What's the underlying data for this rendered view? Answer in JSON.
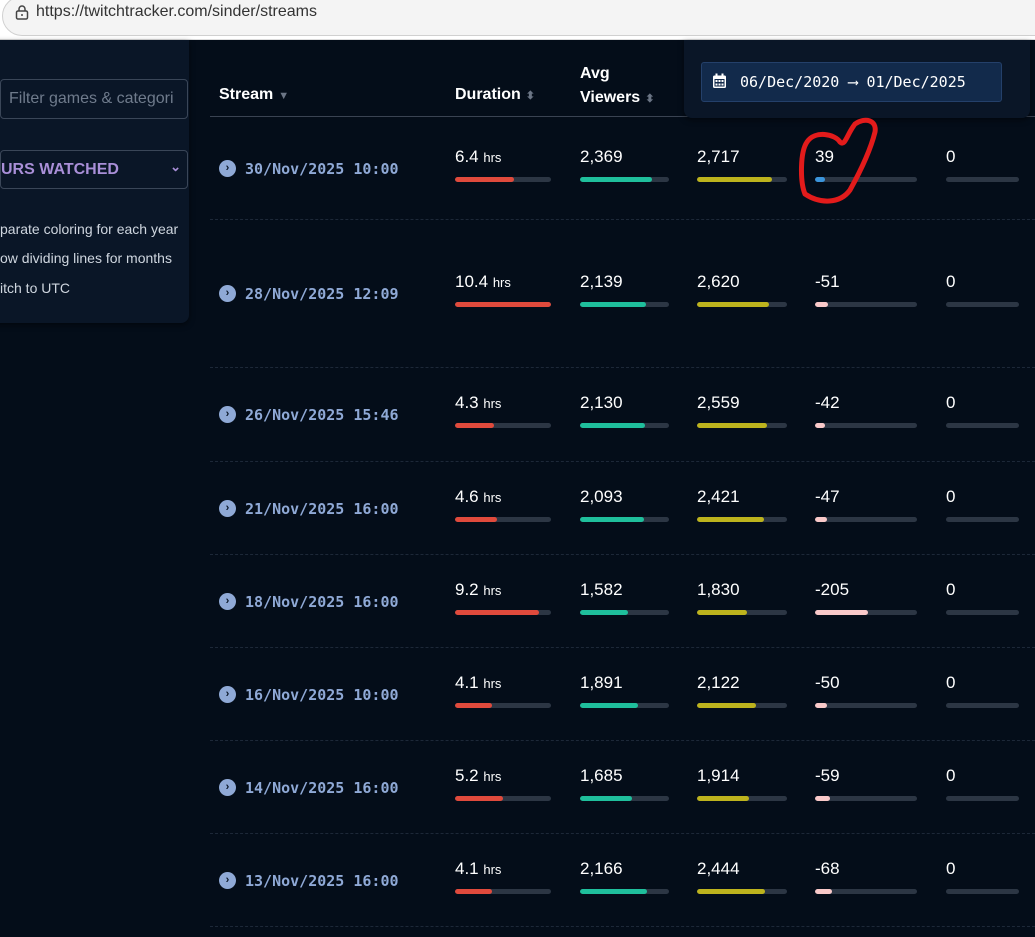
{
  "browser": {
    "url": "https://twitchtracker.com/sinder/streams"
  },
  "sidebar": {
    "filter_placeholder": "Filter games & categori",
    "sort_select": "URS WATCHED",
    "options": [
      "parate coloring for each year",
      "ow dividing lines for months",
      "itch to UTC"
    ]
  },
  "date_range": {
    "from": "06/Dec/2020",
    "arrow": "⟶",
    "to": "01/Dec/2025"
  },
  "table": {
    "headers": {
      "stream": "Stream",
      "duration": "Duration",
      "avg_viewers_1": "Avg",
      "avg_viewers_2": "Viewers"
    },
    "unit": "hrs",
    "colors": {
      "duration": "#e04a3c",
      "avg": "#1fbf9c",
      "peak": "#bdb31d",
      "followers_pos": "#3b95dc",
      "followers_neg": "#f9c9c9"
    },
    "rows": [
      {
        "date": "30/Nov/2025 10:00",
        "duration": "6.4",
        "duration_frac": 0.61,
        "avg": "2,369",
        "avg_frac": 0.81,
        "peak": "2,717",
        "peak_frac": 0.83,
        "followers": "39",
        "followers_frac": 0.1,
        "last": "0"
      },
      {
        "date": "28/Nov/2025 12:09",
        "duration": "10.4",
        "duration_frac": 1.0,
        "avg": "2,139",
        "avg_frac": 0.74,
        "peak": "2,620",
        "peak_frac": 0.8,
        "followers": "-51",
        "followers_frac": 0.13,
        "last": "0"
      },
      {
        "date": "26/Nov/2025 15:46",
        "duration": "4.3",
        "duration_frac": 0.41,
        "avg": "2,130",
        "avg_frac": 0.73,
        "peak": "2,559",
        "peak_frac": 0.78,
        "followers": "-42",
        "followers_frac": 0.1,
        "last": "0"
      },
      {
        "date": "21/Nov/2025 16:00",
        "duration": "4.6",
        "duration_frac": 0.44,
        "avg": "2,093",
        "avg_frac": 0.72,
        "peak": "2,421",
        "peak_frac": 0.74,
        "followers": "-47",
        "followers_frac": 0.12,
        "last": "0"
      },
      {
        "date": "18/Nov/2025 16:00",
        "duration": "9.2",
        "duration_frac": 0.88,
        "avg": "1,582",
        "avg_frac": 0.54,
        "peak": "1,830",
        "peak_frac": 0.56,
        "followers": "-205",
        "followers_frac": 0.52,
        "last": "0"
      },
      {
        "date": "16/Nov/2025 10:00",
        "duration": "4.1",
        "duration_frac": 0.39,
        "avg": "1,891",
        "avg_frac": 0.65,
        "peak": "2,122",
        "peak_frac": 0.65,
        "followers": "-50",
        "followers_frac": 0.12,
        "last": "0"
      },
      {
        "date": "14/Nov/2025 16:00",
        "duration": "5.2",
        "duration_frac": 0.5,
        "avg": "1,685",
        "avg_frac": 0.58,
        "peak": "1,914",
        "peak_frac": 0.58,
        "followers": "-59",
        "followers_frac": 0.15,
        "last": "0"
      },
      {
        "date": "13/Nov/2025 16:00",
        "duration": "4.1",
        "duration_frac": 0.39,
        "avg": "2,166",
        "avg_frac": 0.75,
        "peak": "2,444",
        "peak_frac": 0.75,
        "followers": "-68",
        "followers_frac": 0.17,
        "last": "0"
      }
    ]
  }
}
